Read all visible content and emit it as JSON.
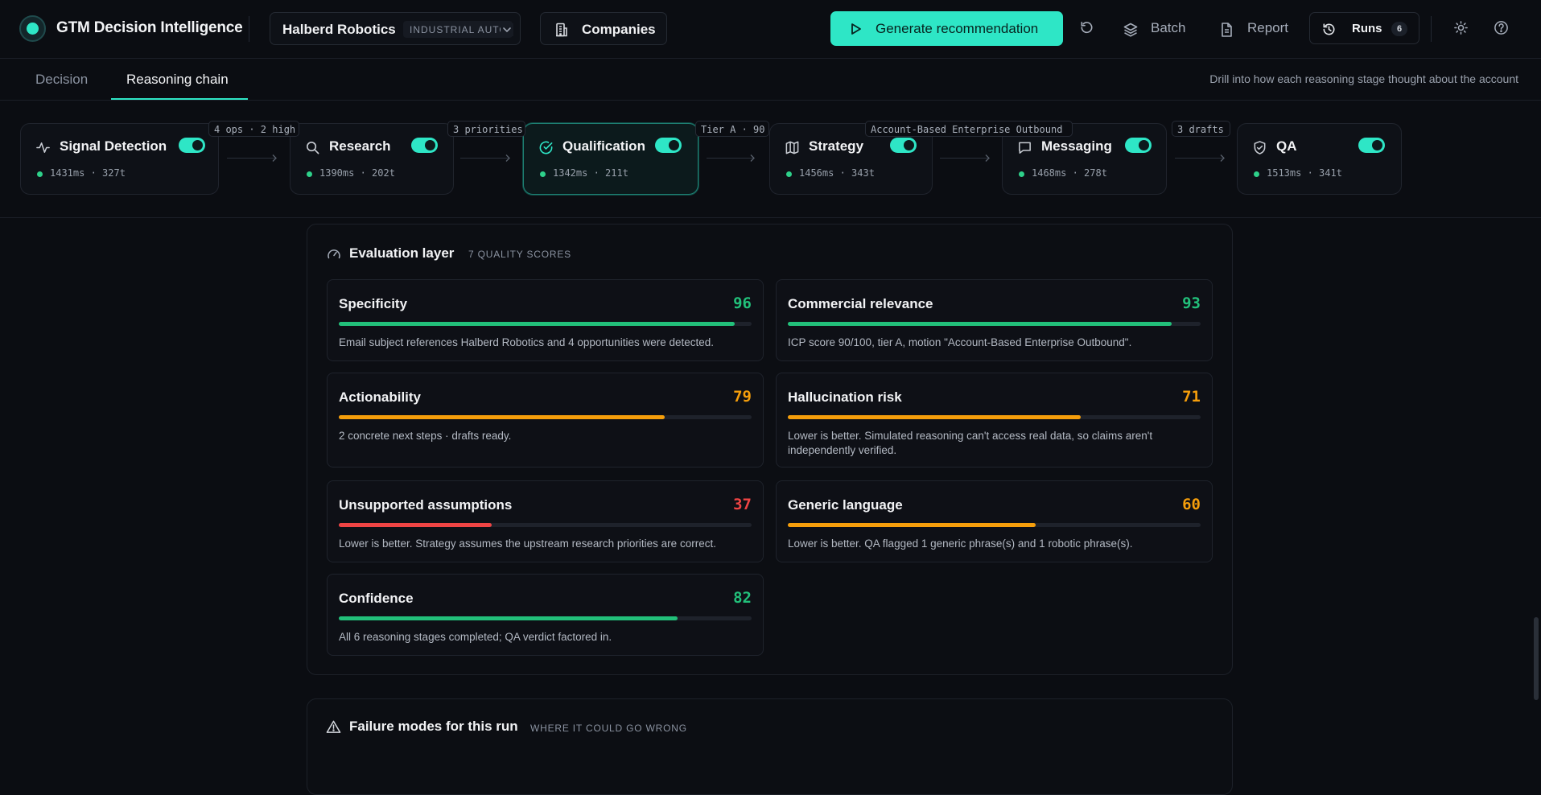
{
  "app": {
    "title": "GTM Decision Intelligence"
  },
  "company": {
    "name": "Halberd Robotics",
    "tag": "INDUSTRIAL AUTO"
  },
  "nav": {
    "companies_label": "Companies"
  },
  "actions": {
    "generate_label": "Generate recommendation",
    "batch_label": "Batch",
    "report_label": "Report",
    "runs_label": "Runs",
    "runs_count": "6"
  },
  "tabs": {
    "items": [
      {
        "label": "Decision"
      },
      {
        "label": "Reasoning chain"
      }
    ],
    "active": "Reasoning chain",
    "hint": "Drill into how each reasoning stage thought about the account"
  },
  "pipeline": {
    "stages": [
      {
        "name": "Signal Detection",
        "meta": "1431ms · 327t",
        "enabled": true,
        "icon": "activity-icon"
      },
      {
        "name": "Research",
        "meta": "1390ms · 202t",
        "enabled": true,
        "icon": "search-icon"
      },
      {
        "name": "Qualification",
        "meta": "1342ms · 211t",
        "enabled": true,
        "icon": "check-circle-icon",
        "active": true
      },
      {
        "name": "Strategy",
        "meta": "1456ms · 343t",
        "enabled": true,
        "icon": "map-icon"
      },
      {
        "name": "Messaging",
        "meta": "1468ms · 278t",
        "enabled": true,
        "icon": "message-icon"
      },
      {
        "name": "QA",
        "meta": "1513ms · 341t",
        "enabled": true,
        "icon": "shield-check-icon"
      }
    ],
    "connectors": [
      {
        "label": "4 ops · 2 high"
      },
      {
        "label": "3 priorities"
      },
      {
        "label": "Tier A · 90"
      },
      {
        "label": "Account-Based Enterprise Outbound"
      },
      {
        "label": "3 drafts"
      }
    ]
  },
  "evaluation": {
    "title": "Evaluation layer",
    "subtitle": "7 QUALITY SCORES",
    "scores": [
      {
        "name": "Specificity",
        "score": "96",
        "value": 96,
        "color": "#22c07a",
        "desc": "Email subject references Halberd Robotics and 4 opportunities were detected."
      },
      {
        "name": "Commercial relevance",
        "score": "93",
        "value": 93,
        "color": "#22c07a",
        "desc": "ICP score 90/100, tier A, motion \"Account-Based Enterprise Outbound\"."
      },
      {
        "name": "Actionability",
        "score": "79",
        "value": 79,
        "color": "#f59e0b",
        "desc": "2 concrete next steps · drafts ready."
      },
      {
        "name": "Hallucination risk",
        "score": "71",
        "value": 71,
        "color": "#f59e0b",
        "desc": "Lower is better. Simulated reasoning can't access real data, so claims aren't independently verified."
      },
      {
        "name": "Unsupported assumptions",
        "score": "37",
        "value": 37,
        "color": "#ef4444",
        "desc": "Lower is better. Strategy assumes the upstream research priorities are correct."
      },
      {
        "name": "Generic language",
        "score": "60",
        "value": 60,
        "color": "#f59e0b",
        "desc": "Lower is better. QA flagged 1 generic phrase(s) and 1 robotic phrase(s)."
      },
      {
        "name": "Confidence",
        "score": "82",
        "value": 82,
        "color": "#22c07a",
        "desc": "All 6 reasoning stages completed; QA verdict factored in."
      }
    ]
  },
  "failure": {
    "title": "Failure modes for this run",
    "subtitle": "WHERE IT COULD GO WRONG"
  }
}
